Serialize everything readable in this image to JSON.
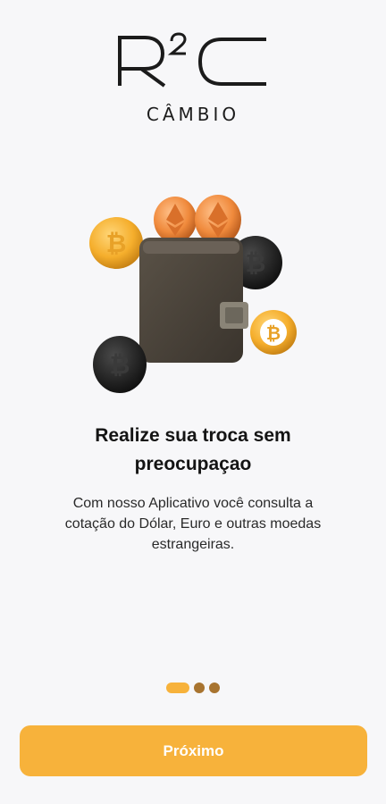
{
  "logo": {
    "mark_text": "R²C",
    "subtitle": "CÂMBIO"
  },
  "illustration": {
    "icon": "wallet-with-crypto-coins-illustration"
  },
  "onboarding": {
    "headline_line1": "Realize sua troca sem",
    "headline_line2": "preocupaçao",
    "description_line1": "Com nosso Aplicativo você consulta a",
    "description_line2": "cotação do Dólar, Euro e outras moedas",
    "description_line3": "estrangeiras."
  },
  "pager": {
    "total": 3,
    "active_index": 0
  },
  "actions": {
    "next_label": "Próximo"
  },
  "colors": {
    "accent": "#f7b23b",
    "dot_inactive": "#a87430",
    "background": "#f7f7f9"
  }
}
